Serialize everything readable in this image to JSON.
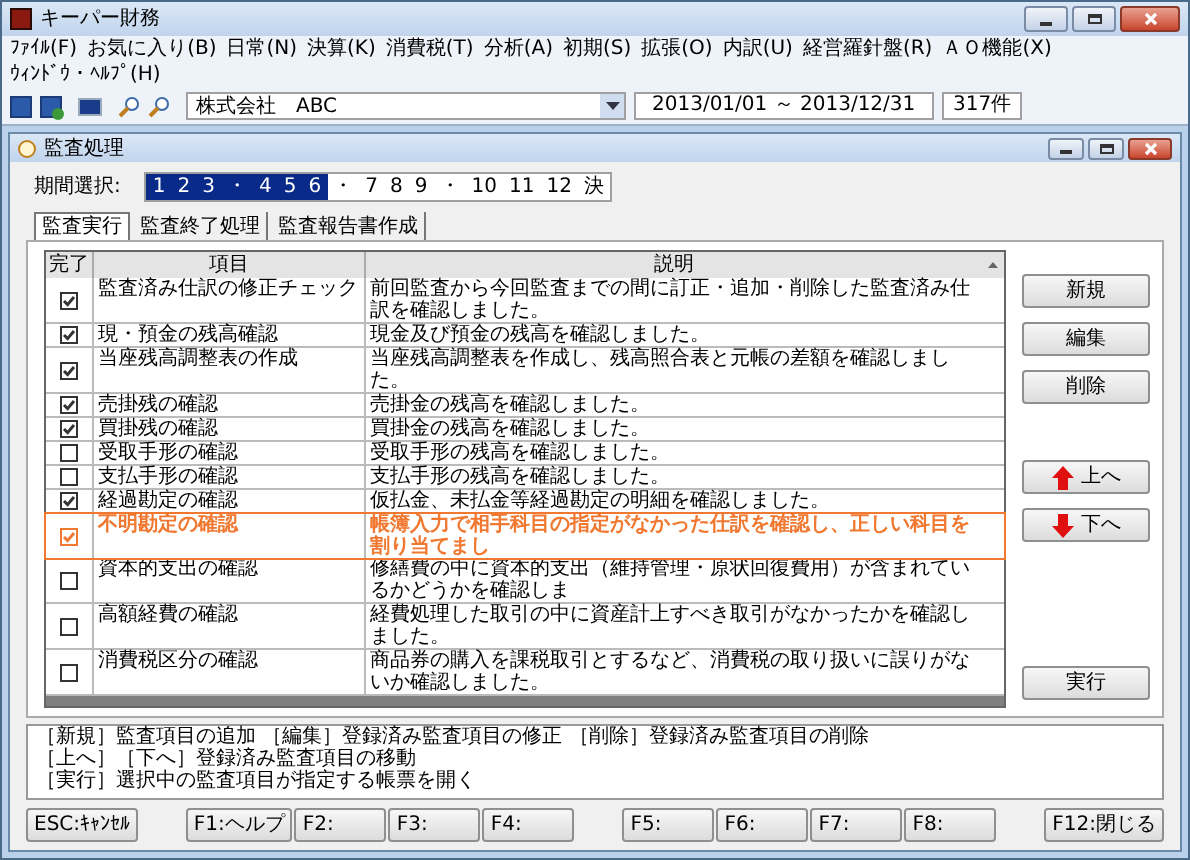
{
  "window": {
    "title": "キーパー財務"
  },
  "menu": [
    "ﾌｧｲﾙ(F)",
    "お気に入り(B)",
    "日常(N)",
    "決算(K)",
    "消費税(T)",
    "分析(A)",
    "初期(S)",
    "拡張(O)",
    "内訳(U)",
    "経営羅針盤(R)",
    "ＡＯ機能(X)",
    "ｳｨﾝﾄﾞｳ・ﾍﾙﾌﾟ(H)"
  ],
  "toolbar": {
    "company": "株式会社　ABC",
    "period": "2013/01/01 ～ 2013/12/31",
    "count": "317件"
  },
  "dialog": {
    "title": "監査処理"
  },
  "period_selector": {
    "label": "期間選択:",
    "items": [
      {
        "label": "1",
        "selected": true
      },
      {
        "label": "2",
        "selected": true
      },
      {
        "label": "3",
        "selected": true
      },
      {
        "label": "・",
        "selected": true
      },
      {
        "label": "4",
        "selected": true
      },
      {
        "label": "5",
        "selected": true
      },
      {
        "label": "6",
        "selected": true
      },
      {
        "label": "・",
        "selected": false
      },
      {
        "label": "7",
        "selected": false
      },
      {
        "label": "8",
        "selected": false
      },
      {
        "label": "9",
        "selected": false
      },
      {
        "label": "・",
        "selected": false
      },
      {
        "label": "10",
        "selected": false
      },
      {
        "label": "11",
        "selected": false
      },
      {
        "label": "12",
        "selected": false
      },
      {
        "label": "決",
        "selected": false
      }
    ]
  },
  "tabs": [
    {
      "label": "監査実行",
      "selected": true
    },
    {
      "label": "監査終了処理",
      "selected": false
    },
    {
      "label": "監査報告書作成",
      "selected": false
    }
  ],
  "table": {
    "columns": [
      "完了",
      "項目",
      "説明"
    ],
    "rows": [
      {
        "checked": true,
        "selected": false,
        "item": "監査済み仕訳の修正チェック",
        "description": "前回監査から今回監査までの間に訂正・追加・削除した監査済み仕訳を確認しました。"
      },
      {
        "checked": true,
        "selected": false,
        "item": "現・預金の残高確認",
        "description": "現金及び預金の残高を確認しました。"
      },
      {
        "checked": true,
        "selected": false,
        "item": "当座残高調整表の作成",
        "description": "当座残高調整表を作成し、残高照合表と元帳の差額を確認しました。"
      },
      {
        "checked": true,
        "selected": false,
        "item": "売掛残の確認",
        "description": "売掛金の残高を確認しました。"
      },
      {
        "checked": true,
        "selected": false,
        "item": "買掛残の確認",
        "description": "買掛金の残高を確認しました。"
      },
      {
        "checked": false,
        "selected": false,
        "item": "受取手形の確認",
        "description": "受取手形の残高を確認しました。"
      },
      {
        "checked": false,
        "selected": false,
        "item": "支払手形の確認",
        "description": "支払手形の残高を確認しました。"
      },
      {
        "checked": true,
        "selected": false,
        "item": "経過勘定の確認",
        "description": "仮払金、未払金等経過勘定の明細を確認しました。"
      },
      {
        "checked": true,
        "selected": true,
        "item": "不明勘定の確認",
        "description": "帳簿入力で相手科目の指定がなかった仕訳を確認し、正しい科目を割り当てまし"
      },
      {
        "checked": false,
        "selected": false,
        "item": "資本的支出の確認",
        "description": "修繕費の中に資本的支出（維持管理・原状回復費用）が含まれているかどうかを確認しま"
      },
      {
        "checked": false,
        "selected": false,
        "item": "高額経費の確認",
        "description": "経費処理した取引の中に資産計上すべき取引がなかったかを確認しました。"
      },
      {
        "checked": false,
        "selected": false,
        "item": "消費税区分の確認",
        "description": "商品券の購入を課税取引とするなど、消費税の取り扱いに誤りがないか確認しました。"
      }
    ]
  },
  "side_buttons": [
    {
      "kind": "plain",
      "label": "新規"
    },
    {
      "kind": "plain",
      "label": "編集"
    },
    {
      "kind": "plain",
      "label": "削除"
    },
    {
      "kind": "gap"
    },
    {
      "kind": "up",
      "label": "上へ"
    },
    {
      "kind": "down",
      "label": "下へ"
    },
    {
      "kind": "bottom",
      "label": "実行"
    }
  ],
  "help_text": [
    "［新規］監査項目の追加 ［編集］登録済み監査項目の修正 ［削除］登録済み監査項目の削除",
    "［上へ］［下へ］登録済み監査項目の移動",
    "［実行］選択中の監査項目が指定する帳票を開く"
  ],
  "function_key_groups": [
    [
      "ESC:ｷｬﾝｾﾙ"
    ],
    [
      "F1:ヘルプ",
      "F2:",
      "F3:",
      "F4:"
    ],
    [
      "F5:",
      "F6:",
      "F7:",
      "F8:"
    ],
    [
      "F12:閉じる"
    ]
  ]
}
